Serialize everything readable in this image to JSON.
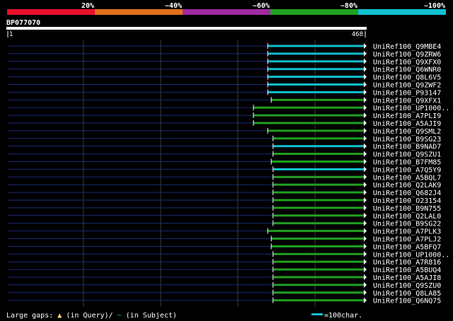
{
  "query": {
    "id": "BP077070",
    "length": 468,
    "ruler_start": "1",
    "ruler_end": "468"
  },
  "identity_scale": {
    "labels": [
      "20%",
      "~40%",
      "~60%",
      "~80%",
      "~100%"
    ],
    "colors": [
      "#e8102a",
      "#e0701a",
      "#a02aa0",
      "#20a020",
      "#10c0d0"
    ]
  },
  "hits": [
    {
      "name": "UniRef100_Q9MBE4",
      "start": 0.73,
      "color": "cyan"
    },
    {
      "name": "UniRef100_Q9ZRW6",
      "start": 0.73,
      "color": "cyan"
    },
    {
      "name": "UniRef100_Q9XFX0",
      "start": 0.73,
      "color": "cyan"
    },
    {
      "name": "UniRef100_Q6WNR0",
      "start": 0.73,
      "color": "cyan"
    },
    {
      "name": "UniRef100_Q8L6V5",
      "start": 0.73,
      "color": "cyan"
    },
    {
      "name": "UniRef100_Q9ZWF2",
      "start": 0.73,
      "color": "cyan"
    },
    {
      "name": "UniRef100_P93147",
      "start": 0.73,
      "color": "cyan"
    },
    {
      "name": "UniRef100_Q9XFX1",
      "start": 0.74,
      "color": "green"
    },
    {
      "name": "UniRef100_UP1000..",
      "start": 0.69,
      "color": "green"
    },
    {
      "name": "UniRef100_A7PLI9",
      "start": 0.69,
      "color": "green"
    },
    {
      "name": "UniRef100_A5AJI9",
      "start": 0.69,
      "color": "green"
    },
    {
      "name": "UniRef100_Q9SML2",
      "start": 0.73,
      "color": "green"
    },
    {
      "name": "UniRef100_B9SG23",
      "start": 0.745,
      "color": "green"
    },
    {
      "name": "UniRef100_B9NAD7",
      "start": 0.745,
      "color": "cyan"
    },
    {
      "name": "UniRef100_Q9SZU1",
      "start": 0.745,
      "color": "green"
    },
    {
      "name": "UniRef100_B7FM85",
      "start": 0.74,
      "color": "green"
    },
    {
      "name": "UniRef100_A7Q5Y9",
      "start": 0.745,
      "color": "cyan"
    },
    {
      "name": "UniRef100_A5BQL7",
      "start": 0.745,
      "color": "green"
    },
    {
      "name": "UniRef100_Q2LAK9",
      "start": 0.745,
      "color": "green"
    },
    {
      "name": "UniRef100_Q682J4",
      "start": 0.745,
      "color": "green"
    },
    {
      "name": "UniRef100_O23154",
      "start": 0.745,
      "color": "green"
    },
    {
      "name": "UniRef100_B9N755",
      "start": 0.745,
      "color": "green"
    },
    {
      "name": "UniRef100_Q2LAL0",
      "start": 0.745,
      "color": "green"
    },
    {
      "name": "UniRef100_B9SG22",
      "start": 0.745,
      "color": "green"
    },
    {
      "name": "UniRef100_A7PLK3",
      "start": 0.73,
      "color": "green"
    },
    {
      "name": "UniRef100_A7PLJ2",
      "start": 0.74,
      "color": "green"
    },
    {
      "name": "UniRef100_A5BFQ7",
      "start": 0.74,
      "color": "green"
    },
    {
      "name": "UniRef100_UP1000..",
      "start": 0.745,
      "color": "green"
    },
    {
      "name": "UniRef100_A7R816",
      "start": 0.745,
      "color": "green"
    },
    {
      "name": "UniRef100_A5BUQ4",
      "start": 0.745,
      "color": "green"
    },
    {
      "name": "UniRef100_A5AJI8",
      "start": 0.745,
      "color": "green"
    },
    {
      "name": "UniRef100_Q9SZU0",
      "start": 0.745,
      "color": "green"
    },
    {
      "name": "UniRef100_Q8LA85",
      "start": 0.745,
      "color": "green"
    },
    {
      "name": "UniRef100_Q6NQ75",
      "start": 0.745,
      "color": "green"
    }
  ],
  "footer": {
    "gaps_label": "Large gaps:",
    "gaps_query_marker": "▲",
    "gaps_query_text": "(in Query)/",
    "gaps_subject_marker": "~",
    "gaps_subject_text": " (in Subject)",
    "scale_text": "=100char."
  },
  "colors": {
    "cyan": "#10c0d0",
    "green": "#20a020",
    "backbone": "#1a2a7a",
    "gridline": "#3a3a3a"
  }
}
